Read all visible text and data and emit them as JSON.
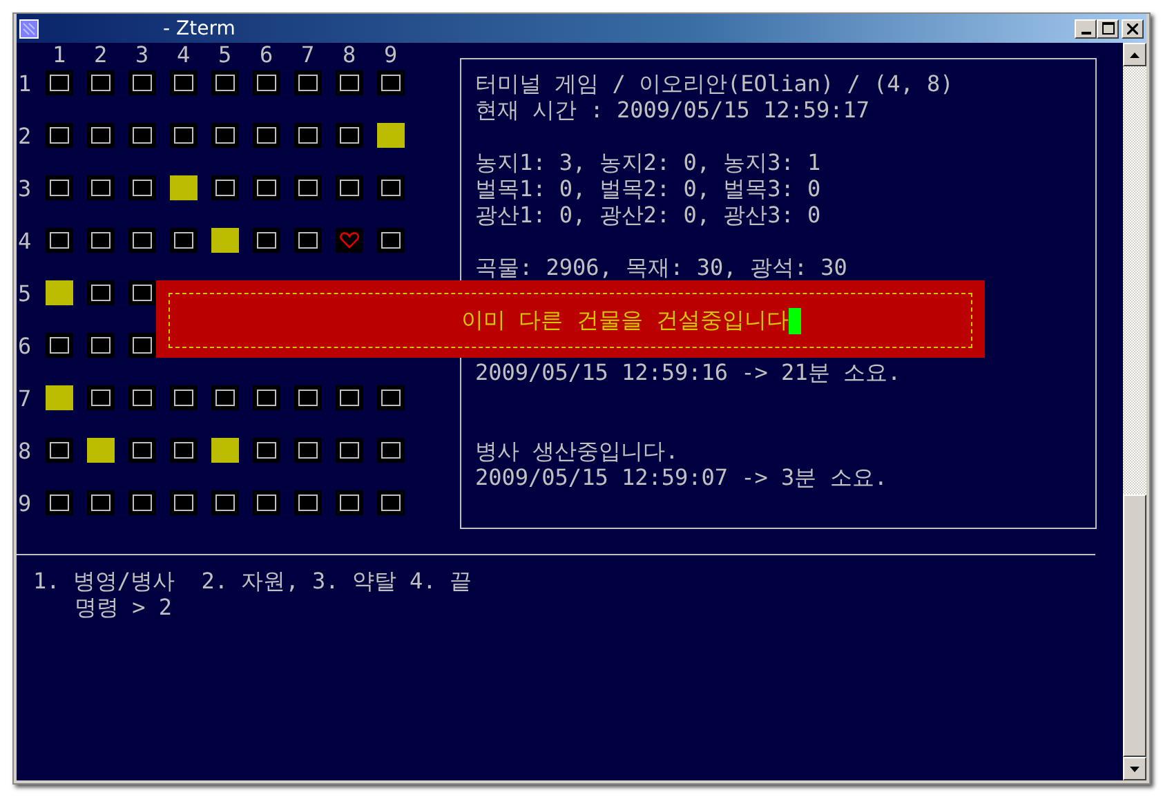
{
  "window": {
    "title": "- Zterm"
  },
  "grid": {
    "column_labels": [
      "1",
      "2",
      "3",
      "4",
      "5",
      "6",
      "7",
      "8",
      "9"
    ],
    "rows": [
      {
        "label": "1",
        "cells": [
          {
            "kind": "empty"
          },
          {
            "kind": "empty"
          },
          {
            "kind": "empty"
          },
          {
            "kind": "empty"
          },
          {
            "kind": "empty"
          },
          {
            "kind": "empty"
          },
          {
            "kind": "empty"
          },
          {
            "kind": "empty"
          },
          {
            "kind": "empty"
          }
        ]
      },
      {
        "label": "2",
        "cells": [
          {
            "kind": "empty"
          },
          {
            "kind": "empty"
          },
          {
            "kind": "empty"
          },
          {
            "kind": "empty"
          },
          {
            "kind": "empty"
          },
          {
            "kind": "empty"
          },
          {
            "kind": "empty"
          },
          {
            "kind": "empty"
          },
          {
            "kind": "filled"
          }
        ]
      },
      {
        "label": "3",
        "cells": [
          {
            "kind": "empty"
          },
          {
            "kind": "empty"
          },
          {
            "kind": "empty"
          },
          {
            "kind": "filled"
          },
          {
            "kind": "empty"
          },
          {
            "kind": "empty"
          },
          {
            "kind": "empty"
          },
          {
            "kind": "empty"
          },
          {
            "kind": "empty"
          }
        ]
      },
      {
        "label": "4",
        "cells": [
          {
            "kind": "empty"
          },
          {
            "kind": "empty"
          },
          {
            "kind": "empty"
          },
          {
            "kind": "empty"
          },
          {
            "kind": "filled"
          },
          {
            "kind": "empty"
          },
          {
            "kind": "empty"
          },
          {
            "kind": "heart"
          },
          {
            "kind": "empty"
          }
        ]
      },
      {
        "label": "5",
        "cells": [
          {
            "kind": "filled"
          },
          {
            "kind": "empty"
          },
          {
            "kind": "empty"
          }
        ]
      },
      {
        "label": "6",
        "cells": [
          {
            "kind": "empty"
          },
          {
            "kind": "empty"
          },
          {
            "kind": "empty"
          }
        ]
      },
      {
        "label": "7",
        "cells": [
          {
            "kind": "filled"
          },
          {
            "kind": "empty"
          },
          {
            "kind": "empty"
          },
          {
            "kind": "empty"
          },
          {
            "kind": "empty"
          },
          {
            "kind": "empty"
          },
          {
            "kind": "empty"
          },
          {
            "kind": "empty"
          },
          {
            "kind": "empty"
          }
        ]
      },
      {
        "label": "8",
        "cells": [
          {
            "kind": "empty"
          },
          {
            "kind": "filled"
          },
          {
            "kind": "empty"
          },
          {
            "kind": "empty"
          },
          {
            "kind": "filled"
          },
          {
            "kind": "empty"
          },
          {
            "kind": "empty"
          },
          {
            "kind": "empty"
          },
          {
            "kind": "empty"
          }
        ]
      },
      {
        "label": "9",
        "cells": [
          {
            "kind": "empty"
          },
          {
            "kind": "empty"
          },
          {
            "kind": "empty"
          },
          {
            "kind": "empty"
          },
          {
            "kind": "empty"
          },
          {
            "kind": "empty"
          },
          {
            "kind": "empty"
          },
          {
            "kind": "empty"
          },
          {
            "kind": "empty"
          }
        ]
      }
    ]
  },
  "info_panel": {
    "groups": [
      [
        "터미널 게임 / 이오리안(EOlian) / (4, 8)",
        "현재 시간 : 2009/05/15 12:59:17"
      ],
      [
        "농지1: 3, 농지2: 0, 농지3: 1",
        "벌목1: 0, 벌목2: 0, 벌목3: 0",
        "광산1: 0, 광산2: 0, 광산3: 0"
      ],
      [
        "곡물: 2906, 목재: 30, 광석: 30"
      ],
      [
        "2009/05/15 12:59:16 -> 21분 소요."
      ],
      [
        "병사 생산중입니다.",
        "2009/05/15 12:59:07 -> 3분 소요."
      ]
    ]
  },
  "popup": {
    "message": "이미 다른 건물을 건설중입니다"
  },
  "menu": {
    "options": "1. 병영/병사  2. 자원, 3. 약탈 4. 끝",
    "prompt": "명령 > 2"
  }
}
